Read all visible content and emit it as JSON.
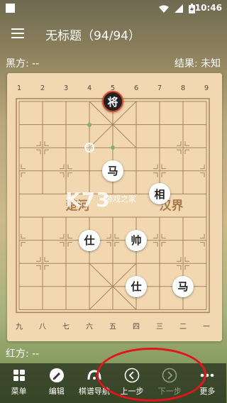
{
  "status": {
    "time": "10:46"
  },
  "app": {
    "title": "无标题（94/94）"
  },
  "info": {
    "black_side": "黑方: --",
    "result": "结果: 未知",
    "red_side": "红方: --"
  },
  "board": {
    "top_files": [
      "1",
      "2",
      "3",
      "4",
      "5",
      "6",
      "7",
      "8",
      "9"
    ],
    "bottom_files": [
      "九",
      "八",
      "七",
      "六",
      "五",
      "四",
      "三",
      "二",
      "一"
    ],
    "river_left": "楚河",
    "river_right": "汉界",
    "pieces": [
      {
        "name": "black-general",
        "char": "将",
        "side": "black",
        "file": 5,
        "rank": 1
      },
      {
        "name": "red-horse-center",
        "char": "马",
        "side": "red",
        "file": 5,
        "rank": 4
      },
      {
        "name": "red-elephant",
        "char": "相",
        "side": "red",
        "file": 7,
        "rank": 5
      },
      {
        "name": "red-advisor-left",
        "char": "仕",
        "side": "red",
        "file": 4,
        "rank": 7
      },
      {
        "name": "red-king",
        "char": "帅",
        "side": "red",
        "file": 6,
        "rank": 7
      },
      {
        "name": "red-advisor-bottom",
        "char": "仕",
        "side": "red",
        "file": 6,
        "rank": 9
      },
      {
        "name": "red-horse-right",
        "char": "马",
        "side": "red",
        "file": 8,
        "rank": 9
      }
    ]
  },
  "watermark": {
    "logo": "K73",
    "sub": "游戏之家"
  },
  "toolbar": {
    "menu": "菜单",
    "edit": "编辑",
    "navigator": "棋谱导航",
    "prev": "上一步",
    "next": "下一步",
    "more": "更多"
  }
}
